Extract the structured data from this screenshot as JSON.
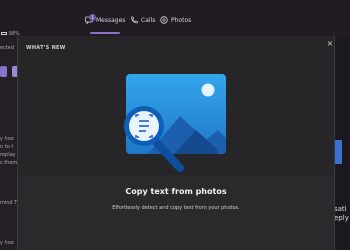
{
  "tabs": {
    "messages": "Messages",
    "calls": "Calls",
    "photos": "Photos",
    "messages_badge": "1"
  },
  "left_panel": {
    "battery": "98%",
    "connected": "ected",
    "line1": "y hoo",
    "line2": "n to t",
    "line3": "replay",
    "line4": "s them",
    "line5": "mind T",
    "line6": "y hoo"
  },
  "right_panel": {
    "line1": "sati",
    "line2": "eply"
  },
  "modal": {
    "title": "WHAT'S NEW",
    "close_label": "×",
    "headline": "Copy text from photos",
    "description": "Effortlessly detect and copy text from your photos."
  },
  "colors": {
    "accent": "#8a72c8",
    "illustration_blue": "#1f8fd6",
    "magnifier": "#1565c0"
  }
}
